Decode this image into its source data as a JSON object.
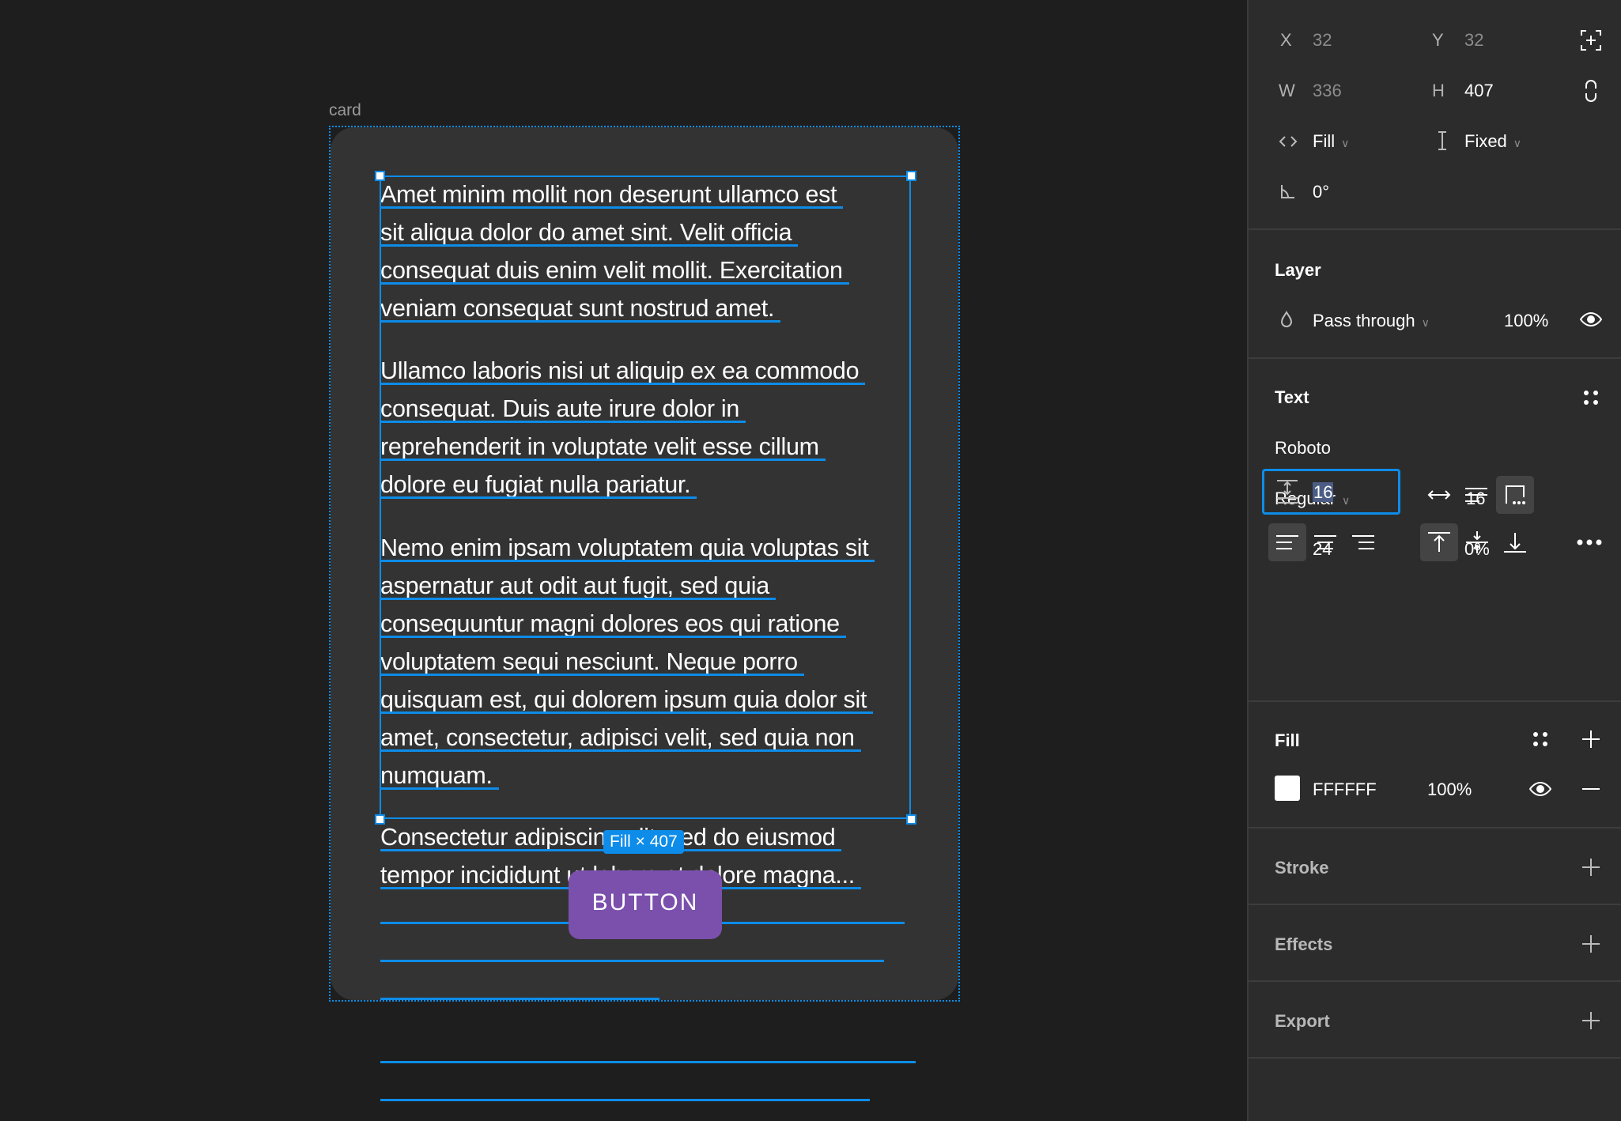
{
  "canvas": {
    "frame_label": "card",
    "paragraphs": [
      [
        "Amet minim mollit non deserunt ullamco est",
        "sit aliqua dolor do amet sint. Velit officia",
        "consequat duis enim velit mollit. Exercitation",
        "veniam consequat sunt nostrud amet."
      ],
      [
        "Ullamco laboris nisi ut aliquip ex ea commodo",
        "consequat. Duis aute irure dolor in",
        "reprehenderit in voluptate velit esse cillum",
        "dolore eu fugiat nulla pariatur."
      ],
      [
        "Nemo enim ipsam voluptatem quia voluptas sit",
        "aspernatur aut odit aut fugit, sed quia",
        "consequuntur magni dolores eos qui ratione",
        "voluptatem sequi nesciunt. Neque porro",
        "quisquam est, qui dolorem ipsum quia dolor sit",
        "amet, consectetur, adipisci velit, sed quia non",
        "numquam."
      ],
      [
        "Consectetur adipiscing elit, sed do eiusmod",
        "tempor incididunt ut labore et dolore magna..."
      ]
    ],
    "size_badge": "Fill × 407",
    "button_label": "BUTTON",
    "colors": {
      "selection": "#0d8ce9",
      "button": "#7b50ad",
      "card": "#333333"
    }
  },
  "panel": {
    "position": {
      "x_label": "X",
      "x": "32",
      "y_label": "Y",
      "y": "32"
    },
    "size": {
      "w_label": "W",
      "w": "336",
      "h_label": "H",
      "h": "407"
    },
    "resizing": {
      "horizontal": "Fill",
      "vertical": "Fixed"
    },
    "rotation": "0°",
    "layer": {
      "title": "Layer",
      "blend": "Pass through",
      "opacity": "100%"
    },
    "text": {
      "title": "Text",
      "font": "Roboto",
      "weight": "Regular",
      "size": "16",
      "line_height": "24",
      "letter_spacing": "0%",
      "paragraph_spacing": "16"
    },
    "fill": {
      "title": "Fill",
      "hex": "FFFFFF",
      "opacity": "100%",
      "color": "#ffffff"
    },
    "stroke": {
      "title": "Stroke"
    },
    "effects": {
      "title": "Effects"
    },
    "export": {
      "title": "Export"
    }
  }
}
